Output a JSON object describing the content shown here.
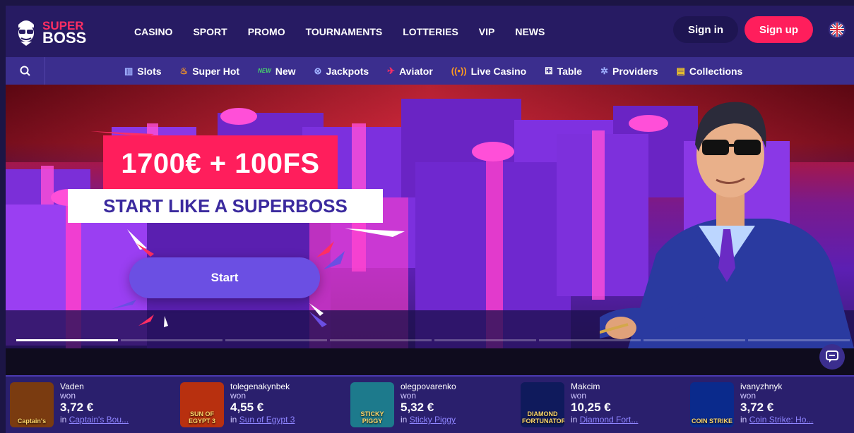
{
  "logo": {
    "super": "SUPER",
    "boss": "BOSS"
  },
  "nav": [
    "CASINO",
    "SPORT",
    "PROMO",
    "TOURNAMENTS",
    "LOTTERIES",
    "VIP",
    "NEWS"
  ],
  "auth": {
    "signin": "Sign in",
    "signup": "Sign up"
  },
  "subnav": [
    {
      "label": "Slots",
      "icon": "slots-icon",
      "color": "#9fb0ff",
      "glyph": "▥"
    },
    {
      "label": "Super Hot",
      "icon": "fire-icon",
      "color": "#ff9a1f",
      "glyph": "♨"
    },
    {
      "label": "New",
      "icon": "new-badge-icon",
      "color": "#47d86b",
      "glyph": "NEW"
    },
    {
      "label": "Jackpots",
      "icon": "jackpot-icon",
      "color": "#9fb0ff",
      "glyph": "⊗"
    },
    {
      "label": "Aviator",
      "icon": "aviator-icon",
      "color": "#ff2e63",
      "glyph": "✈"
    },
    {
      "label": "Live Casino",
      "icon": "live-icon",
      "color": "#ff9a1f",
      "glyph": "((•))"
    },
    {
      "label": "Table",
      "icon": "dice-icon",
      "color": "#ffffff",
      "glyph": "⚃"
    },
    {
      "label": "Providers",
      "icon": "gear-icon",
      "color": "#9fb0ff",
      "glyph": "✲"
    },
    {
      "label": "Collections",
      "icon": "collections-icon",
      "color": "#ffd21f",
      "glyph": "▤"
    }
  ],
  "hero": {
    "headline": "1700€ + 100FS",
    "subheadline": "START LIKE A SUPERBOSS",
    "button": "Start"
  },
  "winners": [
    {
      "name": "Vaden",
      "won": "won",
      "amount": "3,72 €",
      "in": "in",
      "game": "Captain's Bou..."
    },
    {
      "name": "tolegenakynbek",
      "won": "won",
      "amount": "4,55 €",
      "in": "in",
      "game": "Sun of Egypt 3"
    },
    {
      "name": "olegpovarenko",
      "won": "won",
      "amount": "5,32 €",
      "in": "in",
      "game": "Sticky Piggy"
    },
    {
      "name": "Makcim",
      "won": "won",
      "amount": "10,25 €",
      "in": "in",
      "game": "Diamond Fort..."
    },
    {
      "name": "ivanyzhnyk",
      "won": "won",
      "amount": "3,72 €",
      "in": "in",
      "game": "Coin Strike: Ho..."
    }
  ],
  "thumbs": [
    {
      "text": "Captain's",
      "bg": "#7a3b10"
    },
    {
      "text": "SUN OF EGYPT 3",
      "bg": "#b8300f"
    },
    {
      "text": "STICKY PIGGY",
      "bg": "#1d7a8c"
    },
    {
      "text": "DIAMOND FORTUNATOR",
      "bg": "#0f1a5c"
    },
    {
      "text": "COIN STRIKE",
      "bg": "#0a2a8c"
    }
  ]
}
